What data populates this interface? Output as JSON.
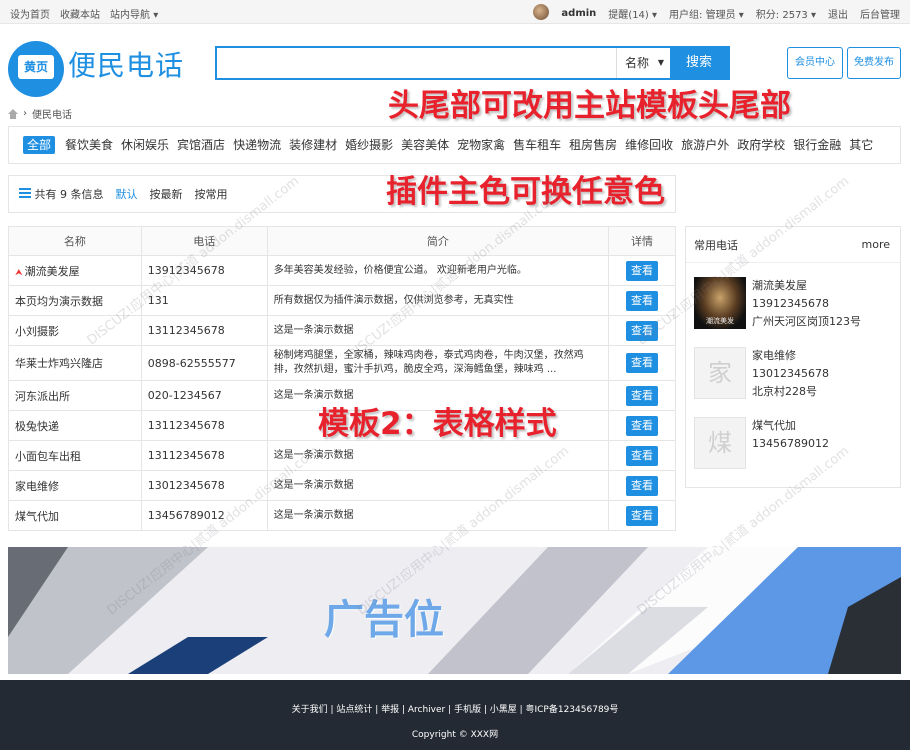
{
  "topbar": {
    "left_links": [
      "设为首页",
      "收藏本站",
      "站内导航"
    ],
    "user": "admin",
    "reminder": "提醒(14)",
    "group": "用户组: 管理员",
    "points": "积分: 2573",
    "logout": "退出",
    "admin": "后台管理"
  },
  "header": {
    "logo_badge": "黄页",
    "logo_text": "便民电话",
    "search_value": "",
    "search_select": "名称",
    "search_button": "搜索",
    "member_button": "会员中心",
    "publish_button": "免费发布"
  },
  "breadcrumb": "便民电话",
  "categories": [
    "全部",
    "餐饮美食",
    "休闲娱乐",
    "宾馆酒店",
    "快递物流",
    "装修建材",
    "婚纱摄影",
    "美容美体",
    "宠物家禽",
    "售车租车",
    "租房售房",
    "维修回收",
    "旅游户外",
    "政府学校",
    "银行金融",
    "其它"
  ],
  "infobar": {
    "count_text": "共有 9 条信息",
    "sort_default": "默认",
    "sort_latest": "按最新",
    "sort_common": "按常用"
  },
  "table": {
    "headers": [
      "名称",
      "电话",
      "简介",
      "详情"
    ],
    "view_label": "查看",
    "rows": [
      {
        "name": "潮流美发屋",
        "phone": "13912345678",
        "desc": "多年美容美发经验，价格便宜公道。 欢迎新老用户光临。"
      },
      {
        "name": "本页均为演示数据",
        "phone": "131",
        "desc": "所有数据仅为插件演示数据，仅供浏览参考，无真实性"
      },
      {
        "name": "小刘摄影",
        "phone": "13112345678",
        "desc": "这是一条演示数据"
      },
      {
        "name": "华莱士炸鸡兴隆店",
        "phone": "0898-62555577",
        "desc": "秘制烤鸡腿堡，全家桶，辣味鸡肉卷，泰式鸡肉卷，牛肉汉堡，孜然鸡排，孜然扒翅，蜜汁手扒鸡，脆皮全鸡，深海鳕鱼堡，辣味鸡 ..."
      },
      {
        "name": "河东派出所",
        "phone": "020-1234567",
        "desc": "这是一条演示数据"
      },
      {
        "name": "极兔快递",
        "phone": "13112345678",
        "desc": ""
      },
      {
        "name": "小面包车出租",
        "phone": "13112345678",
        "desc": "这是一条演示数据"
      },
      {
        "name": "家电维修",
        "phone": "13012345678",
        "desc": "这是一条演示数据"
      },
      {
        "name": "煤气代加",
        "phone": "13456789012",
        "desc": "这是一条演示数据"
      }
    ]
  },
  "sidebar": {
    "title": "常用电话",
    "more": "more",
    "items": [
      {
        "name": "潮流美发屋",
        "phone": "13912345678",
        "address": "广州天河区岗顶123号",
        "thumb_text": "潮流美发"
      },
      {
        "name": "家电维修",
        "phone": "13012345678",
        "address": "北京村228号",
        "thumb_text": "家"
      },
      {
        "name": "煤气代加",
        "phone": "13456789012",
        "address": "",
        "thumb_text": "煤"
      }
    ]
  },
  "overlays": {
    "header_note": "头尾部可改用主站模板头尾部",
    "color_note": "插件主色可换任意色",
    "template_note": "模板2：表格样式",
    "ad_text": "广告位"
  },
  "watermark": "DISCUZ!应用中心|贰道 addon.dismall.com",
  "footer": {
    "links": "关于我们 | 站点统计 | 举报 | Archiver | 手机版 | 小黑屋 | 粤ICP备123456789号",
    "copyright": "Copyright © XXX网"
  },
  "colors": {
    "primary": "#1e8fe1",
    "note_red": "#e8222d",
    "footer_bg": "#242a33"
  }
}
